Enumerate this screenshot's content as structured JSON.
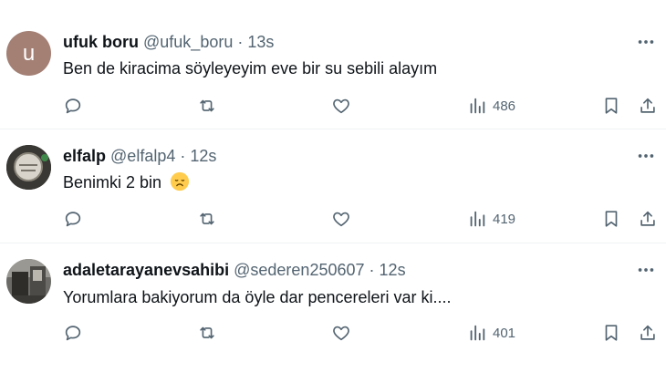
{
  "tweets": [
    {
      "avatar_letter": "u",
      "display_name": "ufuk boru",
      "handle": "@ufuk_boru",
      "separator": "·",
      "time": "13s",
      "text": "Ben de kiracima söyleyeyim  eve bir su sebili alayım",
      "views": "486"
    },
    {
      "display_name": "elfalp",
      "handle": "@elfalp4",
      "separator": "·",
      "time": "12s",
      "text": "Benimki 2 bin",
      "emoji": "disappointed-face",
      "views": "419"
    },
    {
      "display_name": "adaletarayanevsahibi",
      "handle": "@sederen250607",
      "separator": "·",
      "time": "12s",
      "text": "Yorumlara bakiyorum da öyle dar pencereleri var ki....",
      "views": "401"
    }
  ],
  "colors": {
    "text": "#0f1419",
    "secondary": "#536471",
    "divider": "#eff3f4",
    "avatar_u": "#a37f74"
  }
}
